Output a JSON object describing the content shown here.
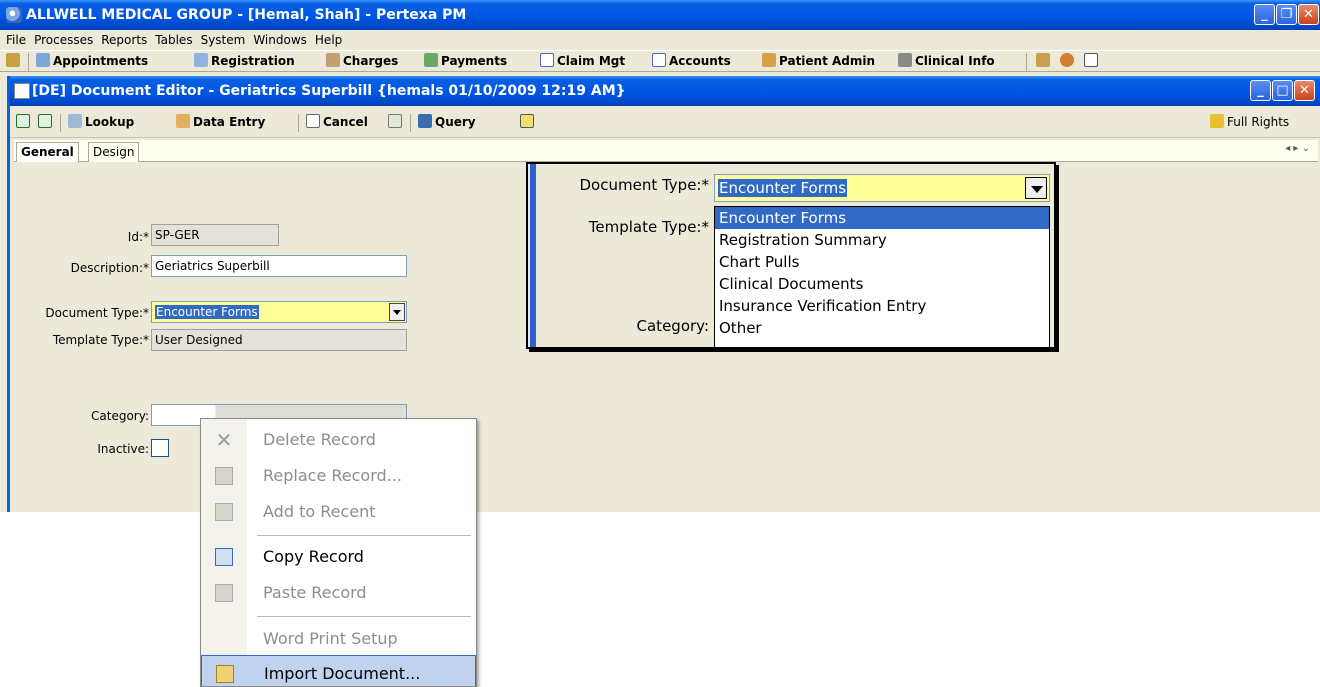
{
  "app": {
    "title": "ALLWELL MEDICAL GROUP - [Hemal, Shah] - Pertexa PM",
    "menu": [
      "File",
      "Processes",
      "Reports",
      "Tables",
      "System",
      "Windows",
      "Help"
    ],
    "toolbar": [
      "Appointments",
      "Registration",
      "Charges",
      "Payments",
      "Claim Mgt",
      "Accounts",
      "Patient Admin",
      "Clinical Info"
    ]
  },
  "doc_window": {
    "title": "[DE] Document Editor - Geriatrics Superbill {hemals 01/10/2009 12:19 AM}",
    "toolbar": {
      "lookup": "Lookup",
      "data_entry": "Data Entry",
      "cancel": "Cancel",
      "query": "Query",
      "full_rights": "Full Rights"
    },
    "tabs": [
      "General",
      "Design"
    ]
  },
  "form": {
    "id_label": "Id:*",
    "id_value": "SP-GER",
    "description_label": "Description:*",
    "description_value": "Geriatrics Superbill",
    "document_type_label": "Document Type:*",
    "document_type_value": "Encounter Forms",
    "template_type_label": "Template Type:*",
    "template_type_value": "User Designed",
    "category_label": "Category:",
    "category_value": "",
    "inactive_label": "Inactive:"
  },
  "zoom": {
    "document_type_label": "Document Type:*",
    "document_type_value": "Encounter Forms",
    "template_type_label": "Template Type:*",
    "category_label": "Category:",
    "options": [
      "Encounter Forms",
      "Registration Summary",
      "Chart Pulls",
      "Clinical Documents",
      "Insurance Verification Entry",
      "Other"
    ]
  },
  "context_menu": {
    "items": [
      {
        "label": "Delete Record",
        "icon": "delete-icon",
        "enabled": false
      },
      {
        "label": "Replace Record...",
        "icon": "replace-icon",
        "enabled": false
      },
      {
        "label": "Add to Recent",
        "icon": "clipboard-icon",
        "enabled": false
      },
      {
        "label": "Copy Record",
        "icon": "copy-icon",
        "enabled": true
      },
      {
        "label": "Paste Record",
        "icon": "paste-icon",
        "enabled": false
      },
      {
        "label": "Word Print Setup",
        "icon": "",
        "enabled": false
      },
      {
        "label": "Import Document...",
        "icon": "folder-open-icon",
        "enabled": true
      }
    ]
  },
  "colors": {
    "titlebar": "#0058e6",
    "selection": "#316ac5",
    "required_field": "#ffff99",
    "menu_highlight": "#c1d2ee"
  }
}
